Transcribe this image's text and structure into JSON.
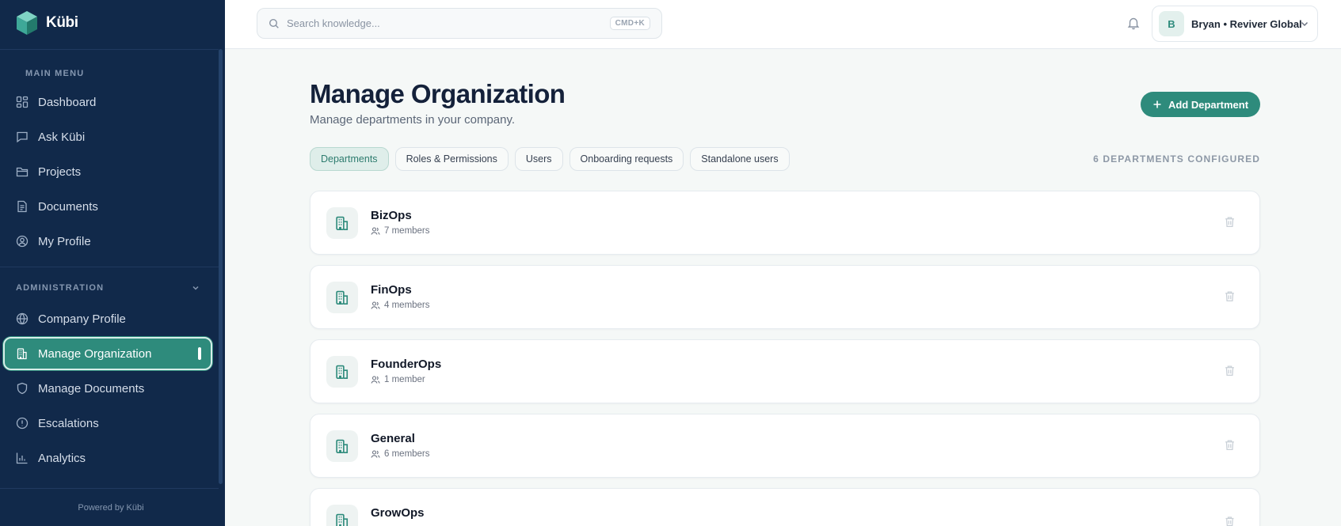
{
  "app": {
    "name": "Kübi"
  },
  "sidebar": {
    "main_menu_label": "MAIN MENU",
    "main_items": [
      {
        "label": "Dashboard",
        "icon": "dashboard-icon"
      },
      {
        "label": "Ask Kübi",
        "icon": "chat-icon"
      },
      {
        "label": "Projects",
        "icon": "folder-icon"
      },
      {
        "label": "Documents",
        "icon": "document-icon"
      },
      {
        "label": "My Profile",
        "icon": "user-circle-icon"
      }
    ],
    "admin_label": "ADMINISTRATION",
    "admin_items": [
      {
        "label": "Company Profile",
        "icon": "globe-icon"
      },
      {
        "label": "Manage Organization",
        "icon": "building-icon",
        "active": true
      },
      {
        "label": "Manage Documents",
        "icon": "shield-icon"
      },
      {
        "label": "Escalations",
        "icon": "alert-circle-icon"
      },
      {
        "label": "Analytics",
        "icon": "bar-chart-icon"
      }
    ],
    "powered_by": "Powered by Kübi"
  },
  "topbar": {
    "search_placeholder": "Search knowledge...",
    "search_shortcut": "CMD+K",
    "user_initial": "B",
    "user_label": "Bryan • Reviver Global"
  },
  "page": {
    "title": "Manage Organization",
    "subtitle": "Manage departments in your company.",
    "add_button": "Add Department",
    "tabs": [
      "Departments",
      "Roles & Permissions",
      "Users",
      "Onboarding requests",
      "Standalone users"
    ],
    "active_tab": "Departments",
    "count_label": "6 DEPARTMENTS CONFIGURED"
  },
  "departments": [
    {
      "name": "BizOps",
      "members": "7 members"
    },
    {
      "name": "FinOps",
      "members": "4 members"
    },
    {
      "name": "FounderOps",
      "members": "1 member"
    },
    {
      "name": "General",
      "members": "6 members"
    },
    {
      "name": "GrowOps",
      "members": ""
    }
  ],
  "colors": {
    "sidebar": "#11294a",
    "accent": "#2e8b7c",
    "background": "#f5f8f7"
  }
}
